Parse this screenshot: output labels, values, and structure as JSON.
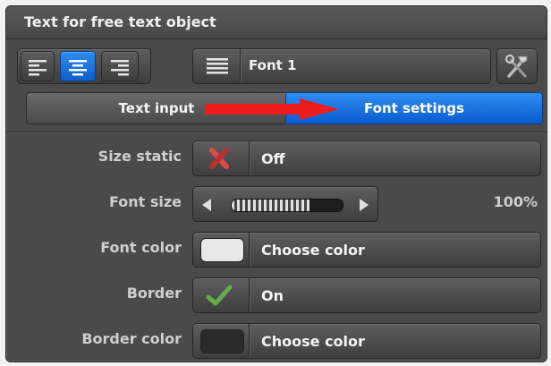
{
  "window": {
    "title": "Text for free text object"
  },
  "toolbar": {
    "align_left_icon": "align-left-icon",
    "align_center_icon": "align-center-icon",
    "align_right_icon": "align-right-icon",
    "align_selected": "center",
    "font_button_label": "Font 1",
    "font_list_icon": "list-icon",
    "tool_icon": "hammer-wrench-icon"
  },
  "tabs": [
    {
      "label": "Text input",
      "active": false
    },
    {
      "label": "Font settings",
      "active": true
    }
  ],
  "settings": {
    "size_static": {
      "label": "Size static",
      "value": "Off",
      "icon": "red-x-icon"
    },
    "font_size": {
      "label": "Font size",
      "value": "100%",
      "slider_fraction": 0.7
    },
    "font_color": {
      "label": "Font color",
      "value": "Choose color",
      "swatch": "#e8e8e8"
    },
    "border": {
      "label": "Border",
      "value": "On",
      "icon": "green-check-icon"
    },
    "border_color": {
      "label": "Border color",
      "value": "Choose color",
      "swatch": "#2a2a2a"
    }
  },
  "colors": {
    "accent": "#1a73e8",
    "arrow": "#ee1c1c",
    "panel": "#4a4a4a"
  }
}
